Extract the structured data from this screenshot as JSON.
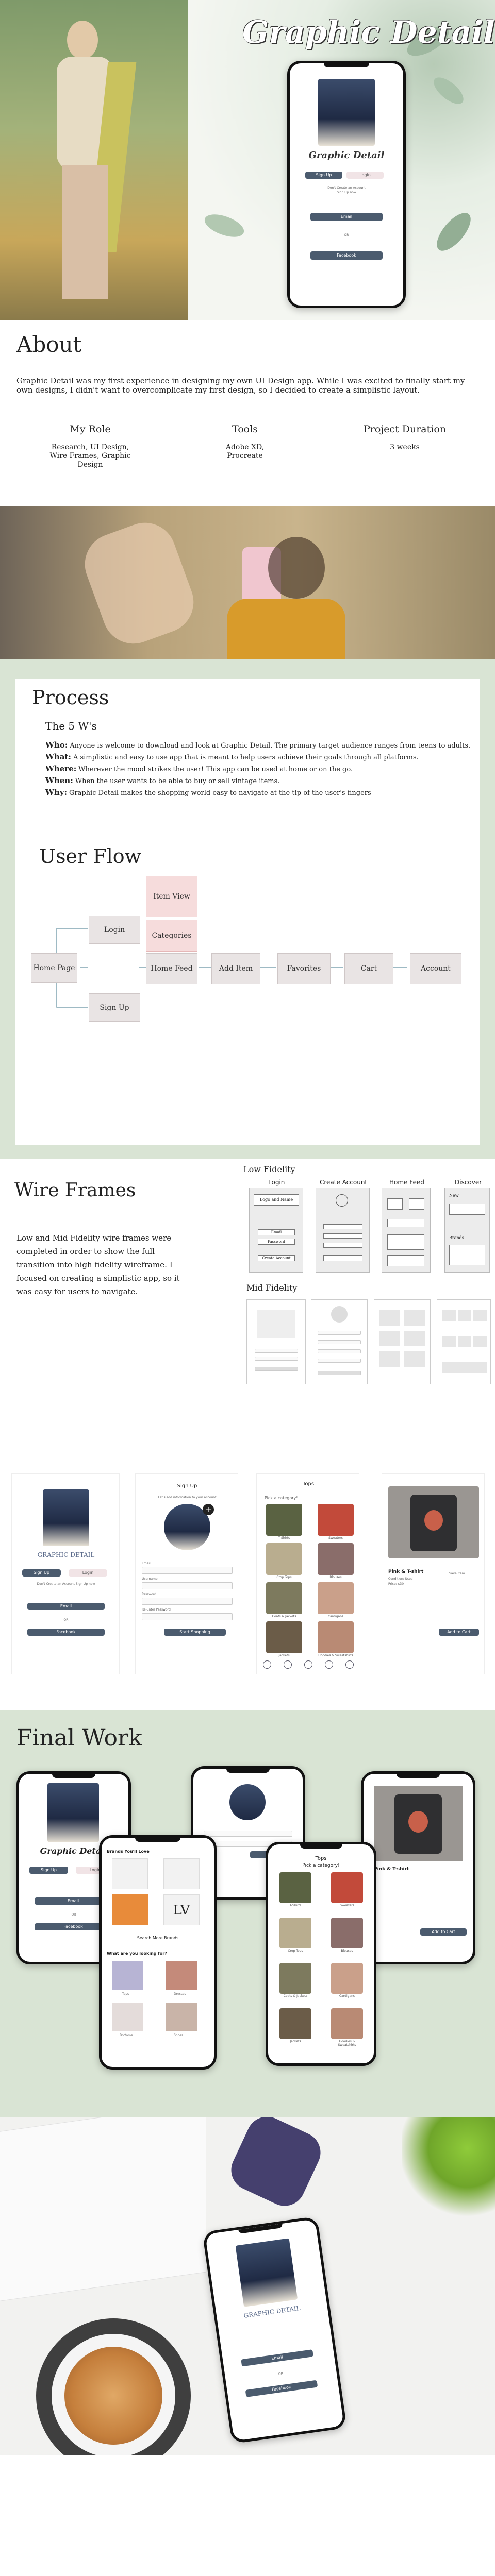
{
  "hero": {
    "title": "Graphic Detail",
    "phone": {
      "brand": "Graphic Detail",
      "tab_signup": "Sign Up",
      "tab_login": "Login",
      "small1": "Don't Create an Account",
      "small2": "Sign Up now",
      "email": "Email",
      "or": "OR",
      "facebook": "Facebook"
    }
  },
  "about": {
    "heading": "About",
    "body": "Graphic Detail was my first experience in designing my own UI Design app. While I was excited to finally start my own designs, I didn't want to overcomplicate my first design, so I decided to create a simplistic layout.",
    "cols": [
      {
        "title": "My Role",
        "text": "Research, UI Design, Wire Frames, Graphic Design"
      },
      {
        "title": "Tools",
        "text": "Adobe XD, Procreate"
      },
      {
        "title": "Project Duration",
        "text": "3 weeks"
      }
    ]
  },
  "process": {
    "heading": "Process",
    "subheading": "The 5 W's",
    "items": [
      {
        "k": "Who:",
        "v": "Anyone is welcome to download and look at Graphic Detail. The primary target audience ranges from teens to adults."
      },
      {
        "k": "What:",
        "v": "A simplistic and easy to use app that is meant to help users achieve their goals through all platforms."
      },
      {
        "k": "Where:",
        "v": "Wherever the mood strikes the user! This app can be used at home or on the go."
      },
      {
        "k": "When:",
        "v": "When the user wants to be able to buy or sell vintage items."
      },
      {
        "k": "Why:",
        "v": "Graphic Detail makes the shopping world easy to navigate at the tip of the user's fingers"
      }
    ]
  },
  "flow": {
    "heading": "User Flow",
    "home": "Home Page",
    "login": "Login",
    "signup": "Sign Up",
    "feed": "Home Feed",
    "categories": "Categories",
    "item": "Item View",
    "add": "Add Item",
    "fav": "Favorites",
    "cart": "Cart",
    "account": "Account"
  },
  "wire": {
    "heading": "Wire Frames",
    "body": "Low and Mid Fidelity wire frames were completed in order to show the full transition into high fidelity wireframe. I focused on creating a simplistic app, so it was easy for users to navigate.",
    "low": "Low Fidelity",
    "mid": "Mid Fidelity",
    "cols": [
      "Login",
      "Create Account",
      "Home Feed",
      "Discover"
    ],
    "low_login": [
      "Logo and Name",
      "Email",
      "Password",
      "Create Account"
    ],
    "low_disc": [
      "New",
      "Brands"
    ],
    "mid_label": "Login"
  },
  "hifi": {
    "s1": {
      "brand": "GRAPHIC DETAIL",
      "signup": "Sign Up",
      "login": "Login",
      "small": "Don't Create an Account Sign Up now",
      "email": "Email",
      "or": "OR",
      "facebook": "Facebook"
    },
    "s2": {
      "title": "Sign Up",
      "sub": "Let's add information to your account",
      "email": "Email",
      "user": "Username",
      "pass": "Password",
      "repass": "Re-Enter Password",
      "btn": "Start Shopping"
    },
    "s3": {
      "title": "Tops",
      "sub": "Pick a category!",
      "cats": [
        "T-Shirts",
        "Sweaters",
        "Crop Tops",
        "Blouses",
        "Coats & Jackets",
        "Cardigans",
        "Jackets",
        "Hoodies & Sweatshirts"
      ]
    },
    "s4": {
      "title": "Pink & T-shirt",
      "line1": "Condition: Used",
      "line2": "Price: $30",
      "add": "Add to Cart",
      "like": "Save Item"
    }
  },
  "final": {
    "heading": "Final Work",
    "p3a": "Brands You'll Love",
    "p3b": "Search More Brands",
    "p3c": "What are you looking for?",
    "p3cats": [
      "Tops",
      "Dresses",
      "Bottoms",
      "Shoes"
    ],
    "p4": "Tops",
    "p4sub": "Pick a category!",
    "login": "Login"
  },
  "mock": {
    "brand": "GRAPHIC DETAIL",
    "email": "Email",
    "or": "OR",
    "facebook": "Facebook"
  }
}
